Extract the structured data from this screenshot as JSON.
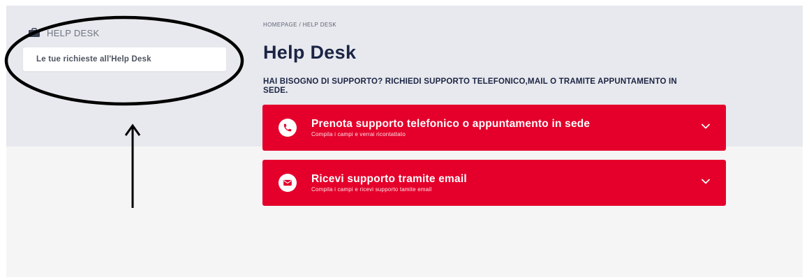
{
  "sidebar": {
    "title": "HELP DESK",
    "icon": "briefcase-icon",
    "items": [
      {
        "label": "Le tue richieste all'Help Desk"
      }
    ]
  },
  "breadcrumb": {
    "home": "HOMEPAGE",
    "separator": "/",
    "current": "HELP DESK"
  },
  "page": {
    "title": "Help Desk",
    "subtitle": "HAI BISOGNO DI SUPPORTO? RICHIEDI SUPPORTO TELEFONICO,MAIL O TRAMITE APPUNTAMENTO IN SEDE."
  },
  "panels": [
    {
      "title": "Prenota supporto telefonico o appuntamento in sede",
      "subtitle": "Compila i campi e verrai ricontattato",
      "icon": "phone-icon"
    },
    {
      "title": "Ricevi supporto tramite email",
      "subtitle": "Compila i campi e ricevi supporto tamite email",
      "icon": "envelope-icon"
    }
  ],
  "colors": {
    "accent": "#e4002b",
    "heading": "#1b2444",
    "band": "#e8e9ee",
    "background": "#f5f5f5",
    "annotation": "#000000"
  }
}
